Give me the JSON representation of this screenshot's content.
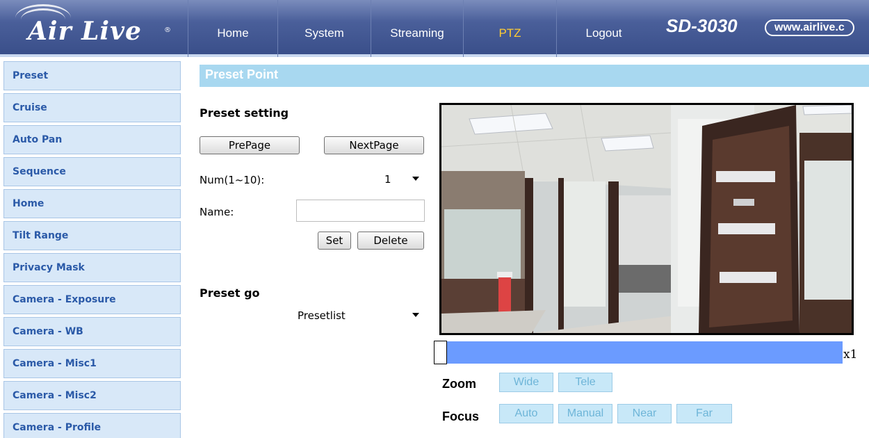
{
  "header": {
    "logo": "Air Live",
    "model": "SD-3030",
    "site": "www.airlive.c",
    "nav": [
      {
        "label": "Home",
        "active": false
      },
      {
        "label": "System",
        "active": false
      },
      {
        "label": "Streaming",
        "active": false
      },
      {
        "label": "PTZ",
        "active": true
      },
      {
        "label": "Logout",
        "active": false
      }
    ]
  },
  "sidebar": {
    "items": [
      {
        "label": "Preset"
      },
      {
        "label": "Cruise"
      },
      {
        "label": "Auto Pan"
      },
      {
        "label": "Sequence"
      },
      {
        "label": "Home"
      },
      {
        "label": "Tilt Range"
      },
      {
        "label": "Privacy Mask"
      },
      {
        "label": "Camera - Exposure"
      },
      {
        "label": "Camera - WB"
      },
      {
        "label": "Camera - Misc1"
      },
      {
        "label": "Camera - Misc2"
      },
      {
        "label": "Camera - Profile"
      }
    ]
  },
  "main": {
    "section_title": "Preset Point",
    "preset_setting": {
      "heading": "Preset setting",
      "prev_label": "PrePage",
      "next_label": "NextPage",
      "num_label": "Num(1~10):",
      "num_value": "1",
      "name_label": "Name:",
      "name_value": "",
      "set_label": "Set",
      "delete_label": "Delete"
    },
    "preset_go": {
      "heading": "Preset go",
      "select_value": "Presetlist"
    },
    "zoom_level": "x1",
    "zoom_label": "Zoom",
    "zoom_buttons": [
      "Wide",
      "Tele"
    ],
    "focus_label": "Focus",
    "focus_buttons": [
      "Auto",
      "Manual",
      "Near",
      "Far"
    ]
  },
  "colors": {
    "header": "#4a5f9a",
    "active_nav": "#ffcc33",
    "sidebar_bg": "#d8e8f8",
    "sidebar_text": "#2b5aa8",
    "section_bar": "#a8d8f0",
    "zoom_bar": "#6b9bff"
  }
}
